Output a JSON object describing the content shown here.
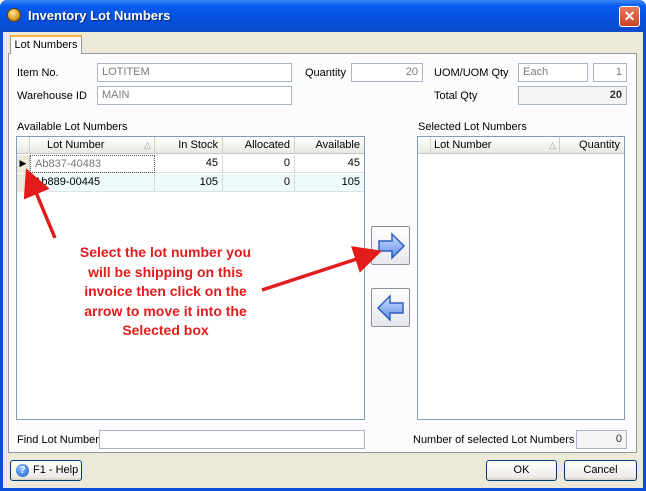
{
  "window": {
    "title": "Inventory Lot Numbers",
    "close_symbol": "✕"
  },
  "tabs": [
    {
      "label": "Lot Numbers"
    }
  ],
  "form": {
    "item_no_label": "Item No.",
    "item_no_value": "LOTITEM",
    "warehouse_label": "Warehouse ID",
    "warehouse_value": "MAIN",
    "quantity_label": "Quantity",
    "quantity_value": "20",
    "uom_label": "UOM/UOM Qty",
    "uom_value": "Each",
    "uom_qty_value": "1",
    "total_qty_label": "Total Qty",
    "total_qty_value": "20"
  },
  "available": {
    "label": "Available Lot Numbers",
    "columns": [
      "Lot Number",
      "In Stock",
      "Allocated",
      "Available"
    ],
    "rows": [
      {
        "lot": "Ab837-40483",
        "in_stock": "45",
        "allocated": "0",
        "available": "45"
      },
      {
        "lot": "Ab889-00445",
        "in_stock": "105",
        "allocated": "0",
        "available": "105"
      }
    ]
  },
  "selected": {
    "label": "Selected Lot Numbers",
    "columns": [
      "Lot Number",
      "Quantity"
    ]
  },
  "buttons": {
    "move_right_icon": "arrow-right",
    "move_left_icon": "arrow-left",
    "help_label": "F1 - Help",
    "ok_label": "OK",
    "cancel_label": "Cancel"
  },
  "footer": {
    "find_label": "Find Lot Number",
    "find_value": "",
    "count_label": "Number of selected Lot Numbers",
    "count_value": "0"
  },
  "annotation": {
    "lines": [
      "Select the lot number you",
      "will be shipping on this",
      "invoice then click on the",
      "arrow to move it into the",
      "Selected box"
    ],
    "color": "#e41b1b"
  },
  "colors": {
    "title_bar": "#0552e0",
    "panel": "#ece9d8",
    "tab_accent": "#f7b33c"
  }
}
